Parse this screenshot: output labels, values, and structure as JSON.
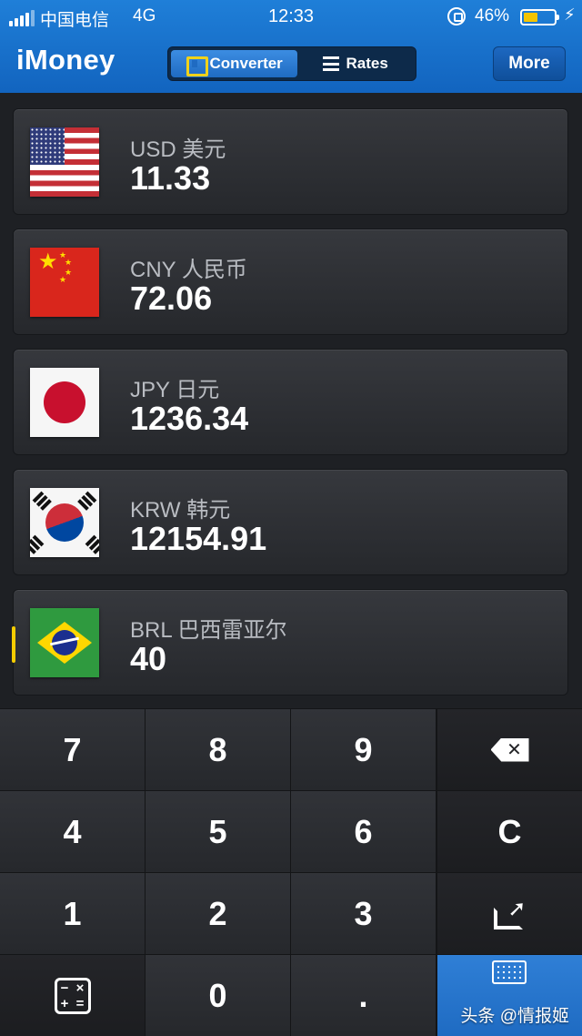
{
  "status_bar": {
    "carrier": "中国电信",
    "network": "4G",
    "time": "12:33",
    "battery_percent": "46%",
    "battery_level": 0.46
  },
  "header": {
    "app_title": "iMoney",
    "tabs": [
      {
        "label": "Converter",
        "icon": "convert-icon",
        "active": true
      },
      {
        "label": "Rates",
        "icon": "list-icon",
        "active": false
      }
    ],
    "more_label": "More"
  },
  "currencies": [
    {
      "code": "USD 美元",
      "amount": "11.33",
      "flag": "us-flag"
    },
    {
      "code": "CNY 人民币",
      "amount": "72.06",
      "flag": "cn-flag"
    },
    {
      "code": "JPY 日元",
      "amount": "1236.34",
      "flag": "jp-flag"
    },
    {
      "code": "KRW 韩元",
      "amount": "12154.91",
      "flag": "kr-flag"
    },
    {
      "code": "BRL 巴西雷亚尔",
      "amount": "40",
      "flag": "br-flag",
      "selected": true
    }
  ],
  "keypad": {
    "keys": [
      "7",
      "8",
      "9",
      "4",
      "5",
      "6",
      "C",
      "1",
      "2",
      "3",
      "0",
      "."
    ],
    "icons": [
      "backspace-icon",
      "share-icon",
      "calculator-icon",
      "keyboard-icon"
    ]
  },
  "watermark": "头条 @情报姬",
  "colors": {
    "header_blue": "#1a72cf",
    "accent_yellow": "#f5cc00",
    "keypad_blue": "#1f6bc2"
  }
}
